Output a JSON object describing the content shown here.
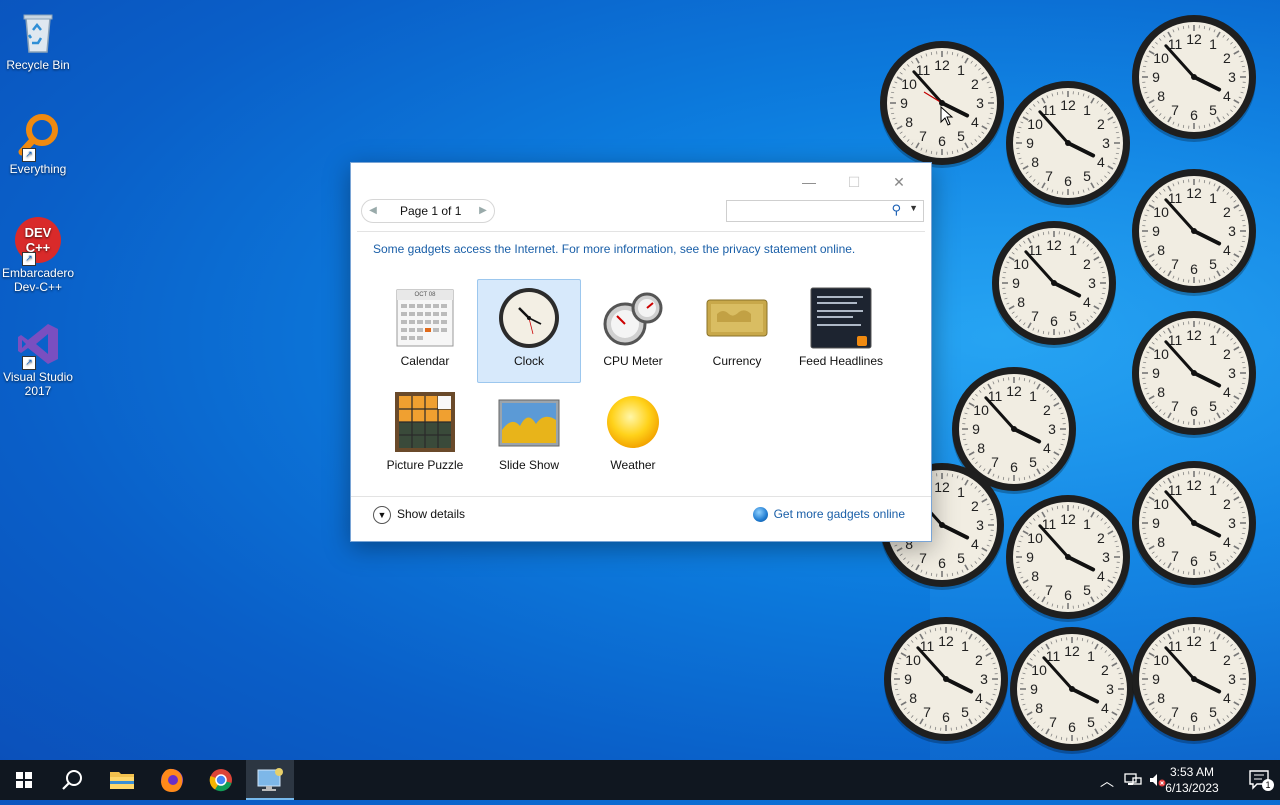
{
  "desktop": {
    "icons": [
      {
        "label": "Recycle Bin"
      },
      {
        "label": "Everything"
      },
      {
        "label": "Embarcadero Dev-C++"
      },
      {
        "label": "Visual Studio 2017"
      }
    ]
  },
  "gadget_window": {
    "pager_label": "Page 1 of 1",
    "search_placeholder": "",
    "privacy_text": "Some gadgets access the Internet.  For more information, see the privacy statement online.",
    "gadgets": [
      {
        "label": "Calendar",
        "selected": false
      },
      {
        "label": "Clock",
        "selected": true
      },
      {
        "label": "CPU Meter",
        "selected": false
      },
      {
        "label": "Currency",
        "selected": false
      },
      {
        "label": "Feed Headlines",
        "selected": false
      },
      {
        "label": "Picture Puzzle",
        "selected": false
      },
      {
        "label": "Slide Show",
        "selected": false
      },
      {
        "label": "Weather",
        "selected": false
      }
    ],
    "calendar_month": "OCT 08",
    "show_details_label": "Show details",
    "more_gadgets_label": "Get more gadgets online"
  },
  "taskbar": {
    "time": "3:53 AM",
    "date": "6/13/2023",
    "notification_count": "1"
  },
  "colors": {
    "accent": "#1a5fa8",
    "selection": "#d7e9fb",
    "taskbar": "#101720"
  }
}
